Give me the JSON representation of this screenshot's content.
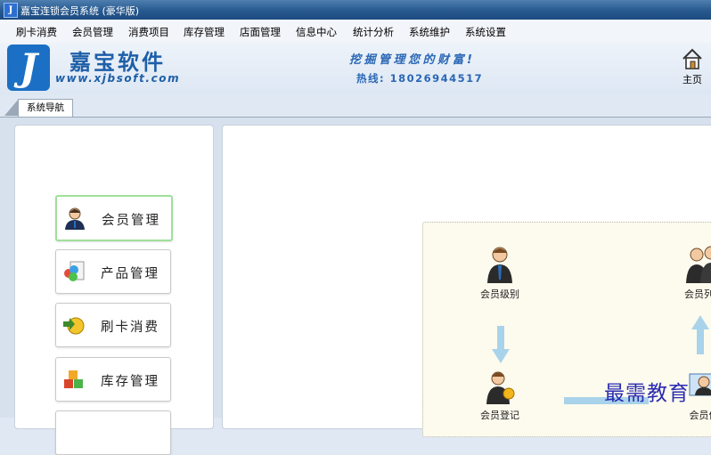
{
  "window": {
    "title": "嘉宝连锁会员系统 (豪华版)",
    "app_icon": "J"
  },
  "menu": [
    "刷卡消费",
    "会员管理",
    "消费项目",
    "库存管理",
    "店面管理",
    "信息中心",
    "统计分析",
    "系统维护",
    "系统设置"
  ],
  "banner": {
    "logo_letter": "J",
    "company": "嘉宝软件",
    "url": "www.xjbsoft.com",
    "slogan": "挖掘管理您的财富!",
    "hotline": "热线: 18026944517",
    "home_label": "主页"
  },
  "tab": "系统导航",
  "nav": [
    {
      "label": "会员管理",
      "icon": "member-icon"
    },
    {
      "label": "产品管理",
      "icon": "product-icon"
    },
    {
      "label": "刷卡消费",
      "icon": "card-swipe-icon"
    },
    {
      "label": "库存管理",
      "icon": "inventory-icon"
    }
  ],
  "flow": {
    "member_level": "会员级别",
    "member_list": "会员列表",
    "member_register": "会员登记",
    "member_info": "会员信"
  },
  "watermark": "最需教育",
  "colors": {
    "brand_blue": "#1e5fa8",
    "active_border": "#9fe09a",
    "arrow": "#a9d3ea",
    "watermark": "#2b2bb0"
  }
}
